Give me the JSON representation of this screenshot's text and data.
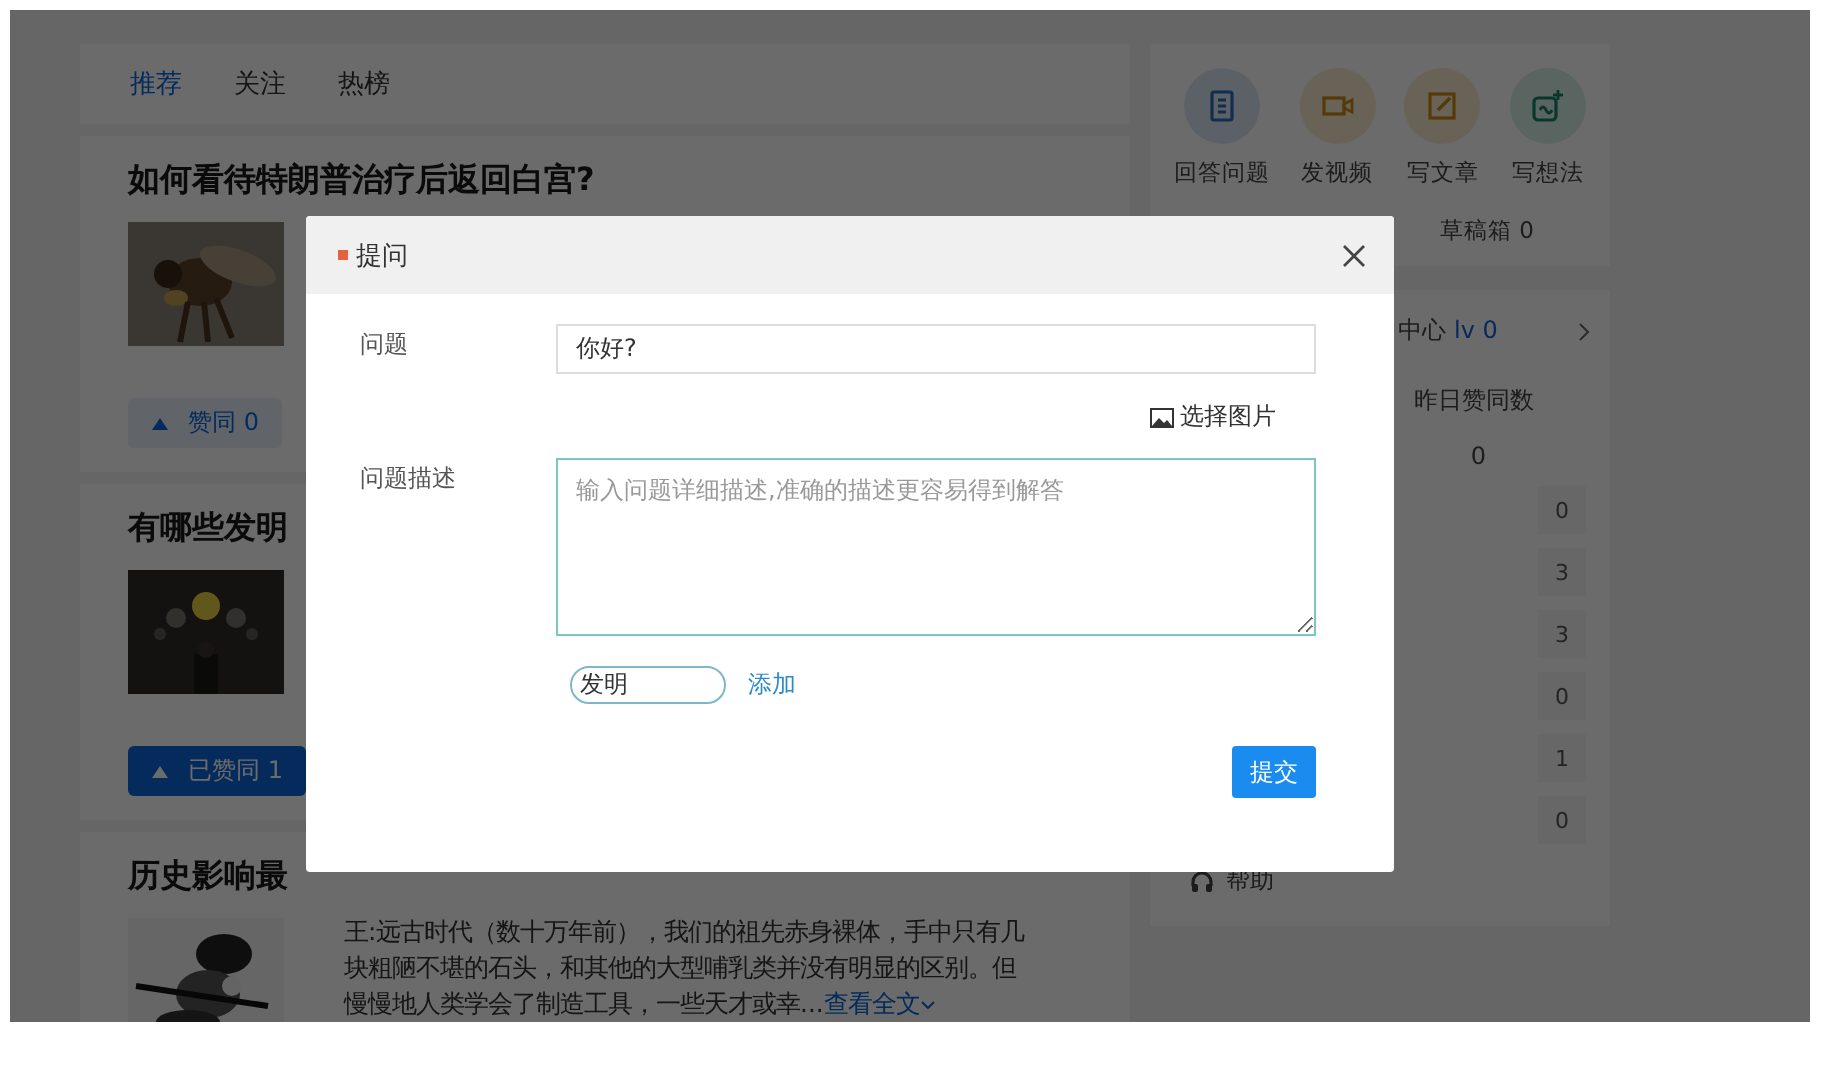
{
  "feed_tabs": [
    {
      "label": "推荐",
      "selected": true
    },
    {
      "label": "关注",
      "selected": false
    },
    {
      "label": "热榜",
      "selected": false
    }
  ],
  "articles": [
    {
      "title": "如何看待特朗普治疗后返回白宫?",
      "vote": {
        "label": "赞同 0",
        "selected": false
      }
    },
    {
      "title": "有哪些发明",
      "vote": {
        "label": "已赞同 1",
        "selected": true
      }
    },
    {
      "title": "历史影响最",
      "excerpt": "王:远古时代（数十万年前），我们的祖先赤身裸体，手中只有几块粗陋不堪的石头，和其他的大型哺乳类并没有明显的区别。但慢慢地人类学会了制造工具，一些天才或幸...",
      "more_link": "查看全文"
    }
  ],
  "side_actions": [
    {
      "kind": "doc",
      "label": "回答问题"
    },
    {
      "kind": "video",
      "label": "发视频"
    },
    {
      "kind": "edit",
      "label": "写文章"
    },
    {
      "kind": "idea",
      "label": "写想法"
    }
  ],
  "drafts": "草稿箱 0",
  "creator": {
    "label": "中心",
    "grade": "lv 0"
  },
  "yesterday": {
    "label": "昨日赞同数",
    "value": "0"
  },
  "stat_values": [
    "0",
    "3",
    "3",
    "0",
    "1",
    "0"
  ],
  "help": "帮助",
  "dialog": {
    "title": "提问",
    "question_label": "问题",
    "question_value": "你好?",
    "choose_image": "选择图片",
    "description_label": "问题描述",
    "description_placeholder": "输入问题详细描述,准确的描述更容易得到解答",
    "tag_value": "发明",
    "add_link": "添加",
    "submit": "提交"
  }
}
